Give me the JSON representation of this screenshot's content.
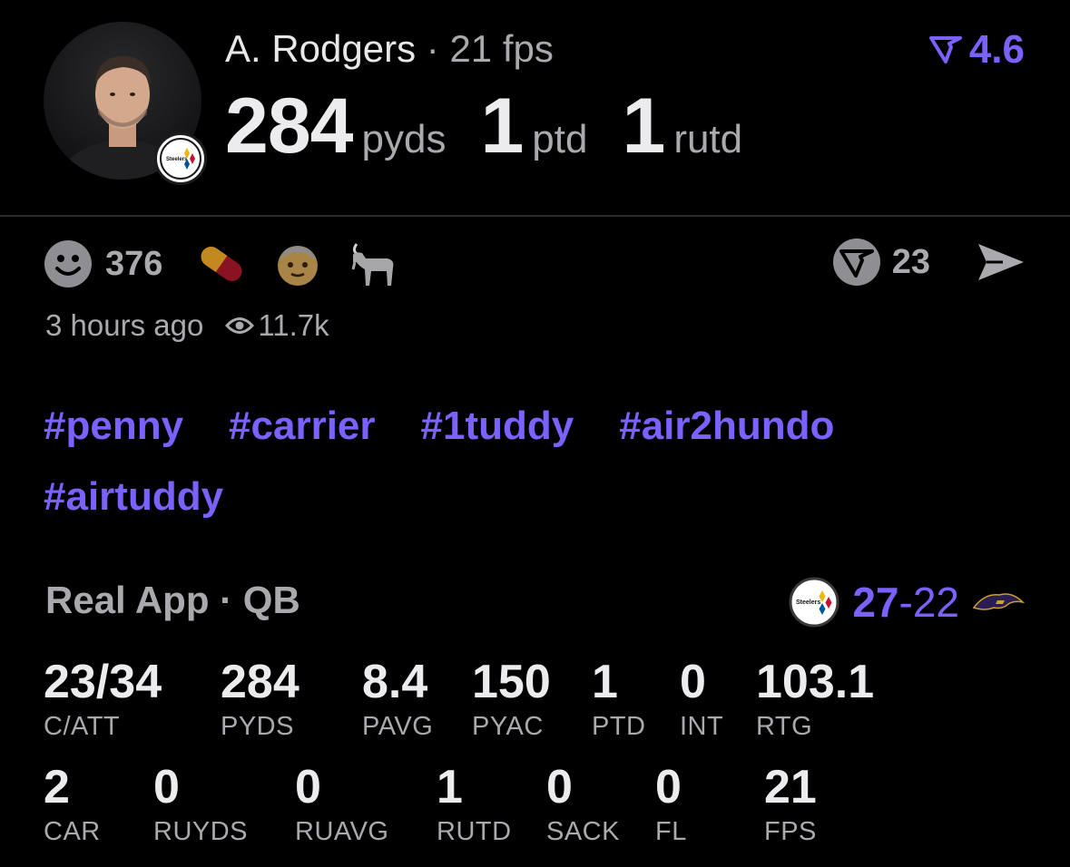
{
  "player": {
    "name": "A. Rodgers",
    "separator": " · ",
    "fps": "21 fps",
    "team_badge_text": "Steelers"
  },
  "rating": {
    "value": "4.6",
    "icon": "real-logo-icon"
  },
  "headline_stats": [
    {
      "value": "284",
      "unit": "pyds"
    },
    {
      "value": "1",
      "unit": "ptd"
    },
    {
      "value": "1",
      "unit": "rutd"
    }
  ],
  "reactions": {
    "count": "376",
    "emoji_icons": [
      "smiley-icon",
      "pill-icon",
      "old-man-icon",
      "goat-icon"
    ]
  },
  "shares": {
    "count": "23",
    "icon": "real-logo-icon"
  },
  "meta": {
    "time_ago": "3 hours ago",
    "views": "11.7k"
  },
  "hashtags": [
    "#penny",
    "#carrier",
    "#1tuddy",
    "#air2hundo",
    "#airtuddy"
  ],
  "game": {
    "label": "Real App · QB",
    "score_team": "27",
    "score_sep": "-",
    "score_opp": "22"
  },
  "stats_row1": [
    {
      "value": "23/34",
      "label": "C/ATT"
    },
    {
      "value": "284",
      "label": "PYDS"
    },
    {
      "value": "8.4",
      "label": "PAVG"
    },
    {
      "value": "150",
      "label": "PYAC"
    },
    {
      "value": "1",
      "label": "PTD"
    },
    {
      "value": "0",
      "label": "INT"
    },
    {
      "value": "103.1",
      "label": "RTG"
    }
  ],
  "stats_row2": [
    {
      "value": "2",
      "label": "CAR"
    },
    {
      "value": "0",
      "label": "RUYDS"
    },
    {
      "value": "0",
      "label": "RUAVG"
    },
    {
      "value": "1",
      "label": "RUTD"
    },
    {
      "value": "0",
      "label": "SACK"
    },
    {
      "value": "0",
      "label": "FL"
    },
    {
      "value": "21",
      "label": "FPS"
    }
  ],
  "colors": {
    "accent": "#7b61ff",
    "muted": "#a9a9ae",
    "background": "#000000"
  }
}
